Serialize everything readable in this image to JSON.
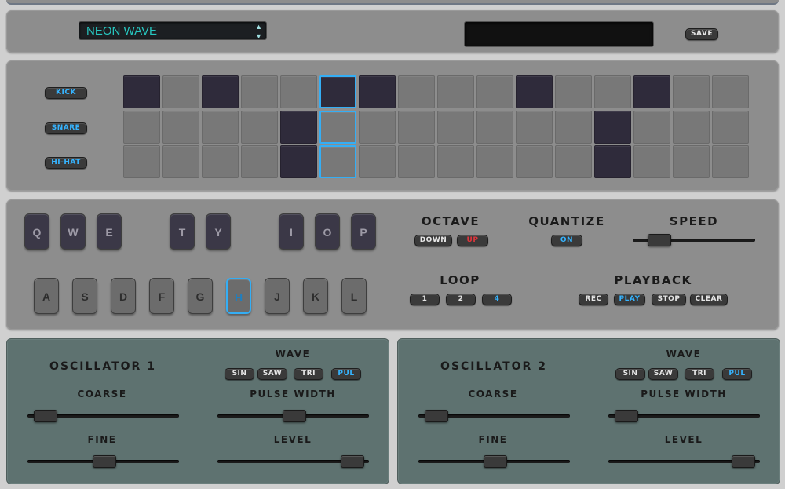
{
  "preset": {
    "selected": "NEON WAVE",
    "name_value": "",
    "save_label": "SAVE"
  },
  "sequencer": {
    "tracks": [
      {
        "label": "KICK",
        "steps": [
          1,
          0,
          1,
          0,
          0,
          1,
          1,
          0,
          0,
          0,
          1,
          0,
          0,
          1,
          0,
          0
        ]
      },
      {
        "label": "SNARE",
        "steps": [
          0,
          0,
          0,
          0,
          1,
          0,
          0,
          0,
          0,
          0,
          0,
          0,
          1,
          0,
          0,
          0
        ]
      },
      {
        "label": "HI-HAT",
        "steps": [
          0,
          0,
          0,
          0,
          1,
          0,
          0,
          0,
          0,
          0,
          0,
          0,
          1,
          0,
          0,
          0
        ]
      }
    ],
    "current_step": 6
  },
  "keyboard": {
    "top_row": [
      "Q",
      "W",
      "E",
      "T",
      "Y",
      "I",
      "O",
      "P"
    ],
    "bottom_row": [
      "A",
      "S",
      "D",
      "F",
      "G",
      "H",
      "J",
      "K",
      "L"
    ],
    "highlighted": "H"
  },
  "octave": {
    "label": "OCTAVE",
    "down": "DOWN",
    "up": "UP"
  },
  "quantize": {
    "label": "QUANTIZE",
    "state": "ON"
  },
  "speed": {
    "label": "SPEED",
    "value": 0.15
  },
  "loop": {
    "label": "LOOP",
    "options": [
      "1",
      "2",
      "4"
    ],
    "selected": "4"
  },
  "playback": {
    "label": "PLAYBACK",
    "buttons": [
      "REC",
      "PLAY",
      "STOP",
      "CLEAR"
    ],
    "active": "PLAY"
  },
  "oscillators": [
    {
      "title": "OSCILLATOR 1",
      "wave_label": "WAVE",
      "waves": [
        "SIN",
        "SAW",
        "TRI",
        "PUL"
      ],
      "active_wave": "PUL",
      "coarse_label": "COARSE",
      "coarse": 0.05,
      "pulse_label": "PULSE WIDTH",
      "pulse_width": 0.5,
      "fine_label": "FINE",
      "fine": 0.5,
      "level_label": "LEVEL",
      "level": 0.95
    },
    {
      "title": "OSCILLATOR 2",
      "wave_label": "WAVE",
      "waves": [
        "SIN",
        "SAW",
        "TRI",
        "PUL"
      ],
      "active_wave": "PUL",
      "coarse_label": "COARSE",
      "coarse": 0.05,
      "pulse_label": "PULSE WIDTH",
      "pulse_width": 0.05,
      "fine_label": "FINE",
      "fine": 0.5,
      "level_label": "LEVEL",
      "level": 0.95
    }
  ],
  "colors": {
    "accent": "#34aef5",
    "display_text": "#27c7c0",
    "rec_red": "#e0353c",
    "step_on": "#2f2b3b",
    "osc_bg": "#5e7270"
  }
}
